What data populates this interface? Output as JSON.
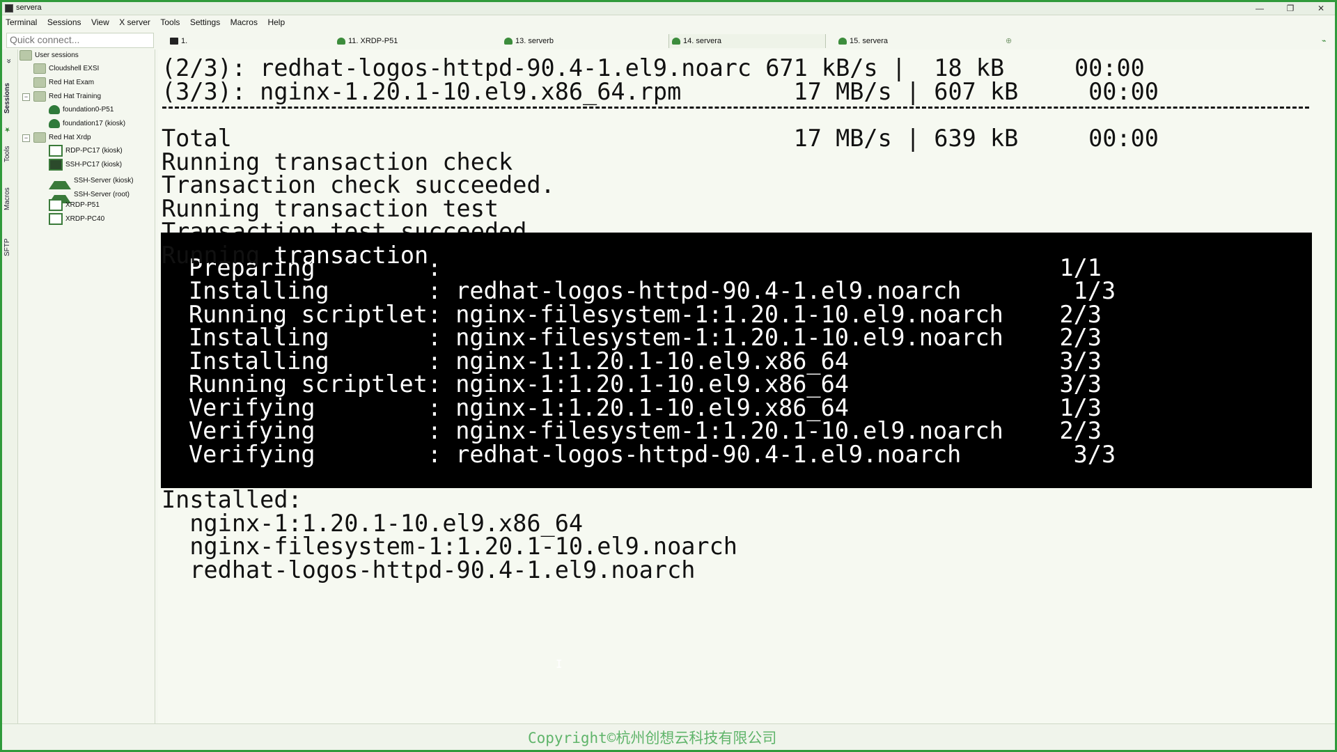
{
  "window": {
    "title": "servera"
  },
  "menu": [
    "Terminal",
    "Sessions",
    "View",
    "X server",
    "Tools",
    "Settings",
    "Macros",
    "Help"
  ],
  "quick_connect": {
    "placeholder": "Quick connect..."
  },
  "tabs": [
    {
      "label": "1.",
      "icon": "terminal-icon"
    },
    {
      "label": "11. XRDP-P51",
      "icon": "session-icon"
    },
    {
      "label": "13. serverb",
      "icon": "session-icon"
    },
    {
      "label": "14. servera",
      "icon": "session-icon",
      "active": true
    },
    {
      "label": "15. servera",
      "icon": "session-icon"
    }
  ],
  "vertical_tabs": [
    "Sessions",
    "Tools",
    "Macros",
    "SFTP"
  ],
  "tree": {
    "root": "User sessions",
    "items": [
      "Cloudshell EXSI",
      "Red Hat Exam",
      "Red Hat Training",
      "foundation0-P51",
      "foundation17 (kiosk)",
      "Red Hat Xrdp",
      "RDP-PC17 (kiosk)",
      "SSH-PC17 (kiosk)",
      "SSH-Server (kiosk)",
      "SSH-Server (root)",
      "XRDP-P51",
      "XRDP-PC40"
    ]
  },
  "terminal": {
    "top_lines": [
      "(2/3): redhat-logos-httpd-90.4-1.el9.noarc 671 kB/s |  18 kB     00:00",
      "(3/3): nginx-1.20.1-10.el9.x86_64.rpm        17 MB/s | 607 kB     00:00"
    ],
    "total_line": "Total                                        17 MB/s | 639 kB     00:00",
    "status_lines": [
      "Running transaction check",
      "Transaction check succeeded.",
      "Running transaction test",
      "Transaction test succeeded."
    ],
    "running_prefix": "Running ",
    "running_highlight": "transaction",
    "block_lines": [
      "Preparing        :                                            1/1",
      "Installing       : redhat-logos-httpd-90.4-1.el9.noarch        1/3",
      "Running scriptlet: nginx-filesystem-1:1.20.1-10.el9.noarch    2/3",
      "Installing       : nginx-filesystem-1:1.20.1-10.el9.noarch    2/3",
      "Installing       : nginx-1:1.20.1-10.el9.x86_64               3/3",
      "Running scriptlet: nginx-1:1.20.1-10.el9.x86_64               3/3",
      "Verifying        : nginx-1:1.20.1-10.el9.x86_64               1/3",
      "Verifying        : nginx-filesystem-1:1.20.1-10.el9.noarch    2/3",
      "Verifying        : redhat-logos-httpd-90.4-1.el9.noarch        3/3"
    ],
    "installed_header": "Installed:",
    "installed": [
      "  nginx-1:1.20.1-10.el9.x86_64",
      "  nginx-filesystem-1:1.20.1-10.el9.noarch",
      "  redhat-logos-httpd-90.4-1.el9.noarch"
    ]
  },
  "status": {
    "copyright": "Copyright©杭州创想云科技有限公司"
  }
}
